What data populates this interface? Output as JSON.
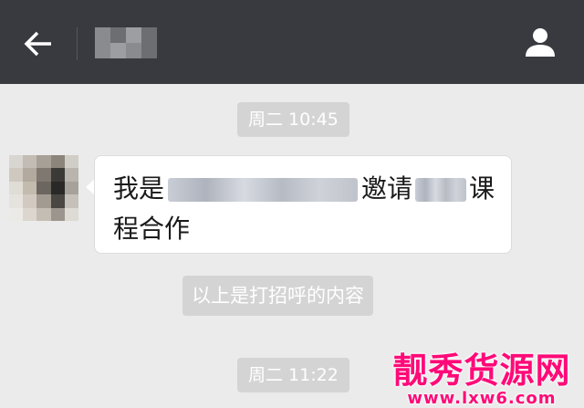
{
  "header": {
    "back_icon": "arrow-left-icon",
    "profile_icon": "person-icon"
  },
  "messages": {
    "time_1": "周二 10:45",
    "incoming_line1_start": "我是",
    "incoming_line1_mid": "邀请",
    "incoming_line1_end": "课",
    "incoming_line2": "程合作",
    "system_note": "以上是打招呼的内容",
    "time_2": "周二 11:22"
  },
  "watermark": {
    "top": "靓秀货源网",
    "bottom": "www.lxw6.com"
  },
  "colors": {
    "header_bg": "#393a3f",
    "chat_bg": "#ebebeb",
    "badge_bg": "#d4d4d4",
    "watermark": "#ff0a78"
  }
}
